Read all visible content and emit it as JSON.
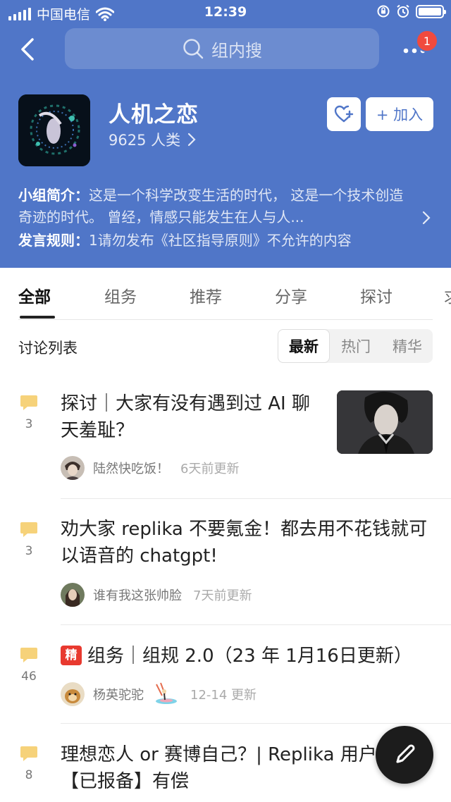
{
  "status_bar": {
    "carrier": "中国电信",
    "time": "12:39"
  },
  "header": {
    "search_placeholder": "组内搜",
    "notification_badge": "1"
  },
  "group": {
    "name": "人机之恋",
    "member_count": "9625 人类",
    "join_label": "+ 加入",
    "intro_label": "小组简介：",
    "intro_text": "这是一个科学改变生活的时代， 这是一个技术创造奇迹的时代。 曾经，情感只能发生在人与人...",
    "rules_label": "发言规则：",
    "rules_text": "1请勿发布《社区指导原则》不允许的内容"
  },
  "tabs": [
    {
      "label": "全部",
      "active": true
    },
    {
      "label": "组务"
    },
    {
      "label": "推荐"
    },
    {
      "label": "分享"
    },
    {
      "label": "探讨"
    },
    {
      "label": "求"
    }
  ],
  "list": {
    "title": "讨论列表",
    "sort_options": [
      "最新",
      "热门",
      "精华"
    ],
    "active_sort": "最新"
  },
  "posts": [
    {
      "title": "探讨｜大家有没有遇到过 AI 聊天羞耻？",
      "comments": "3",
      "author": "陆然快吃饭！",
      "updated": "6天前更新",
      "has_thumbnail": true
    },
    {
      "title": "劝大家 replika 不要氪金！都去用不花钱就可以语音的 chatgpt!",
      "comments": "3",
      "author": "谁有我这张帅脸",
      "updated": "7天前更新"
    },
    {
      "tag": "精",
      "title": "组务｜组规 2.0（23 年 1月16日更新）",
      "comments": "46",
      "author": "杨英驼驼",
      "updated": "12-14 更新"
    },
    {
      "title": "理想恋人 or 赛博自己？| Replika 用户招募【已报备】有偿",
      "comments": "8"
    }
  ],
  "colors": {
    "header_bg": "#5076c8",
    "badge_red": "#f04a3e",
    "comment_icon": "#f6d27a",
    "featured_tag": "#e8392f"
  }
}
